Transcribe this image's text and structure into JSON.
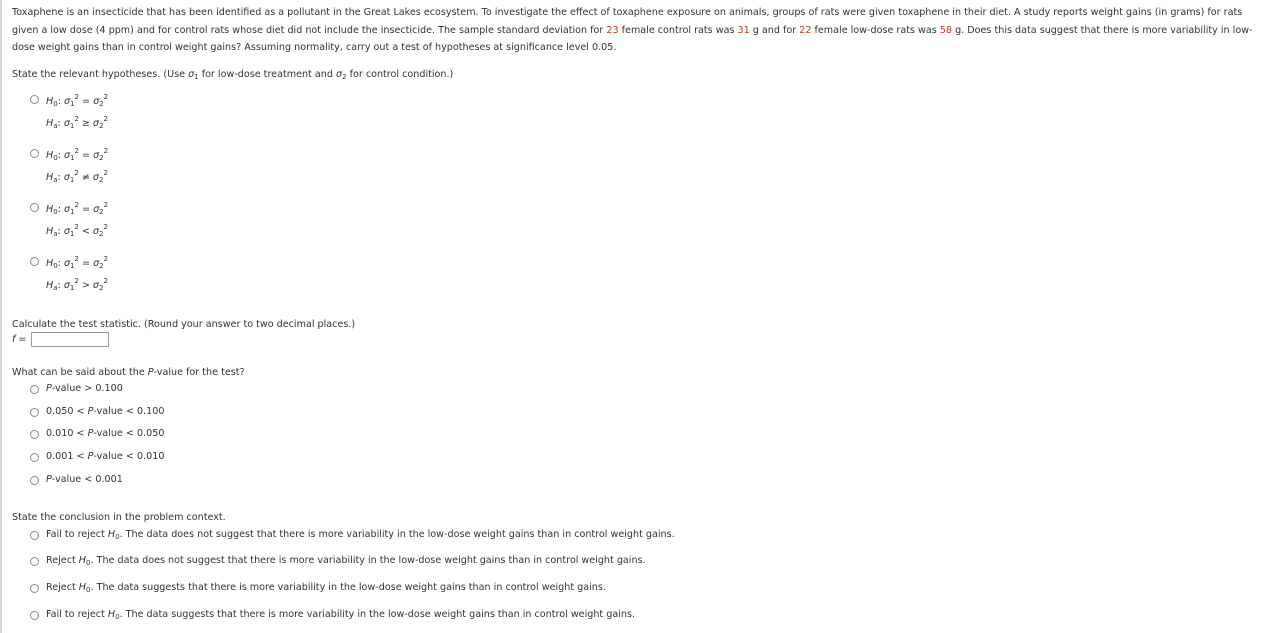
{
  "problem": {
    "intro_parts": [
      "Toxaphene is an insecticide that has been identified as a pollutant in the Great Lakes ecosystem. To investigate the effect of toxaphene exposure on animals, groups of rats were given toxaphene in their diet. A study reports weight gains (in grams) for rats given a low dose (4 ppm) and for control rats whose diet did not include the insecticide. The sample standard deviation for ",
      "23",
      " female control rats was ",
      "31",
      " g and for ",
      "22",
      " female low-dose rats was ",
      "58",
      " g. Does this data suggest that there is more variability in low-dose weight gains than in control weight gains? Assuming normality, carry out a test of hypotheses at significance level 0.05."
    ],
    "highlight_color": "#c0392b"
  },
  "hypotheses": {
    "prompt_a": "State the relevant hypotheses. (Use ",
    "prompt_sigma1": "σ",
    "prompt_sub1": "1",
    "prompt_b": " for low-dose treatment and ",
    "prompt_sigma2": "σ",
    "prompt_sub2": "2",
    "prompt_c": " for control condition.)",
    "h0_label": "H",
    "h0_sub": "0",
    "ha_label": "H",
    "ha_sub": "a",
    "options": [
      {
        "h0_rel": "=",
        "ha_rel": "≥"
      },
      {
        "h0_rel": "=",
        "ha_rel": "≠"
      },
      {
        "h0_rel": "=",
        "ha_rel": "<"
      },
      {
        "h0_rel": "=",
        "ha_rel": ">"
      }
    ]
  },
  "statistic": {
    "prompt": "Calculate the test statistic. (Round your answer to two decimal places.)",
    "label": "f =",
    "value": ""
  },
  "pvalue": {
    "prompt_a": "What can be said about the ",
    "prompt_p": "P",
    "prompt_b": "-value for the test?",
    "options": [
      {
        "pre": "",
        "p": "P",
        "post": "-value > 0.100"
      },
      {
        "pre": "0.050 < ",
        "p": "P",
        "post": "-value < 0.100"
      },
      {
        "pre": "0.010 < ",
        "p": "P",
        "post": "-value < 0.050"
      },
      {
        "pre": "0.001 < ",
        "p": "P",
        "post": "-value < 0.010"
      },
      {
        "pre": "",
        "p": "P",
        "post": "-value < 0.001"
      }
    ]
  },
  "conclusion": {
    "prompt": "State the conclusion in the problem context.",
    "options": [
      {
        "pre": "Fail to reject ",
        "post": ". The data does not suggest that there is more variability in the low-dose weight gains than in control weight gains."
      },
      {
        "pre": "Reject ",
        "post": ". The data does not suggest that there is more variability in the low-dose weight gains than in control weight gains."
      },
      {
        "pre": "Reject ",
        "post": ". The data suggests that there is more variability in the low-dose weight gains than in control weight gains."
      },
      {
        "pre": "Fail to reject ",
        "post": ". The data suggests that there is more variability in the low-dose weight gains than in control weight gains."
      }
    ]
  }
}
